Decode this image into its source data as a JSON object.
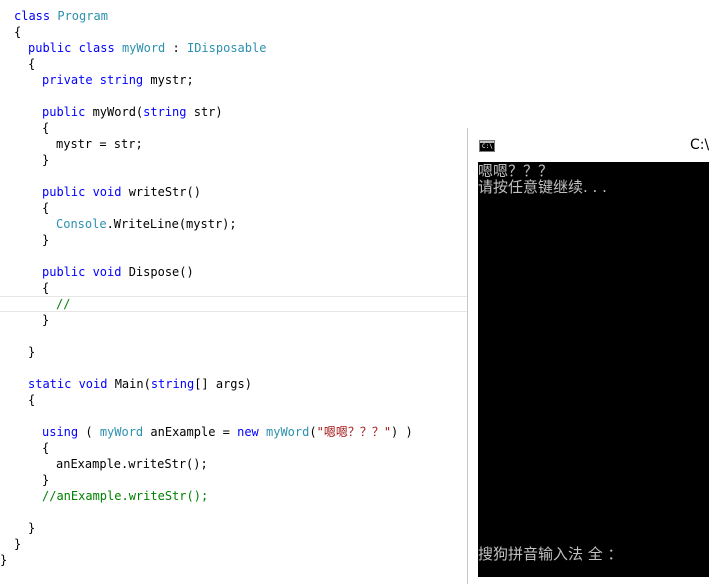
{
  "editor": {
    "lines": [
      {
        "indent": 2,
        "tokens": [
          {
            "t": "class ",
            "c": "kw"
          },
          {
            "t": "Program",
            "c": "type"
          }
        ]
      },
      {
        "indent": 2,
        "tokens": [
          {
            "t": "{",
            "c": "plain"
          }
        ]
      },
      {
        "indent": 4,
        "tokens": [
          {
            "t": "public ",
            "c": "kw"
          },
          {
            "t": "class ",
            "c": "kw"
          },
          {
            "t": "myWord",
            "c": "type"
          },
          {
            "t": " : ",
            "c": "plain"
          },
          {
            "t": "IDisposable",
            "c": "type"
          }
        ]
      },
      {
        "indent": 4,
        "tokens": [
          {
            "t": "{",
            "c": "plain"
          }
        ]
      },
      {
        "indent": 6,
        "tokens": [
          {
            "t": "private ",
            "c": "kw"
          },
          {
            "t": "string ",
            "c": "kw"
          },
          {
            "t": "mystr;",
            "c": "plain"
          }
        ]
      },
      {
        "indent": 0,
        "tokens": []
      },
      {
        "indent": 6,
        "tokens": [
          {
            "t": "public ",
            "c": "kw"
          },
          {
            "t": "myWord(",
            "c": "plain"
          },
          {
            "t": "string ",
            "c": "kw"
          },
          {
            "t": "str)",
            "c": "plain"
          }
        ]
      },
      {
        "indent": 6,
        "tokens": [
          {
            "t": "{",
            "c": "plain"
          }
        ]
      },
      {
        "indent": 8,
        "tokens": [
          {
            "t": "mystr = str;",
            "c": "plain"
          }
        ]
      },
      {
        "indent": 6,
        "tokens": [
          {
            "t": "}",
            "c": "plain"
          }
        ]
      },
      {
        "indent": 0,
        "tokens": []
      },
      {
        "indent": 6,
        "tokens": [
          {
            "t": "public ",
            "c": "kw"
          },
          {
            "t": "void ",
            "c": "kw"
          },
          {
            "t": "writeStr()",
            "c": "plain"
          }
        ]
      },
      {
        "indent": 6,
        "tokens": [
          {
            "t": "{",
            "c": "plain"
          }
        ]
      },
      {
        "indent": 8,
        "tokens": [
          {
            "t": "Console",
            "c": "type"
          },
          {
            "t": ".WriteLine(mystr);",
            "c": "plain"
          }
        ]
      },
      {
        "indent": 6,
        "tokens": [
          {
            "t": "}",
            "c": "plain"
          }
        ]
      },
      {
        "indent": 0,
        "tokens": []
      },
      {
        "indent": 6,
        "tokens": [
          {
            "t": "public ",
            "c": "kw"
          },
          {
            "t": "void ",
            "c": "kw"
          },
          {
            "t": "Dispose()",
            "c": "plain"
          }
        ]
      },
      {
        "indent": 6,
        "tokens": [
          {
            "t": "{",
            "c": "plain"
          }
        ]
      },
      {
        "indent": 8,
        "tokens": [
          {
            "t": "//",
            "c": "comment"
          }
        ]
      },
      {
        "indent": 6,
        "tokens": [
          {
            "t": "}",
            "c": "plain"
          }
        ]
      },
      {
        "indent": 0,
        "tokens": []
      },
      {
        "indent": 4,
        "tokens": [
          {
            "t": "}",
            "c": "plain"
          }
        ]
      },
      {
        "indent": 0,
        "tokens": []
      },
      {
        "indent": 4,
        "tokens": [
          {
            "t": "static ",
            "c": "kw"
          },
          {
            "t": "void ",
            "c": "kw"
          },
          {
            "t": "Main(",
            "c": "plain"
          },
          {
            "t": "string",
            "c": "kw"
          },
          {
            "t": "[] args)",
            "c": "plain"
          }
        ]
      },
      {
        "indent": 4,
        "tokens": [
          {
            "t": "{",
            "c": "plain"
          }
        ]
      },
      {
        "indent": 0,
        "tokens": []
      },
      {
        "indent": 6,
        "tokens": [
          {
            "t": "using",
            "c": "kw"
          },
          {
            "t": " ( ",
            "c": "plain"
          },
          {
            "t": "myWord",
            "c": "type"
          },
          {
            "t": " anExample = ",
            "c": "plain"
          },
          {
            "t": "new ",
            "c": "kw"
          },
          {
            "t": "myWord",
            "c": "type"
          },
          {
            "t": "(",
            "c": "plain"
          },
          {
            "t": "\"嗯嗯？？？\"",
            "c": "str"
          },
          {
            "t": ") )",
            "c": "plain"
          }
        ]
      },
      {
        "indent": 6,
        "tokens": [
          {
            "t": "{",
            "c": "plain"
          }
        ]
      },
      {
        "indent": 8,
        "tokens": [
          {
            "t": "anExample.writeStr();",
            "c": "plain"
          }
        ]
      },
      {
        "indent": 6,
        "tokens": [
          {
            "t": "}",
            "c": "plain"
          }
        ]
      },
      {
        "indent": 6,
        "tokens": [
          {
            "t": "//anExample.writeStr();",
            "c": "comment"
          }
        ]
      },
      {
        "indent": 0,
        "tokens": []
      },
      {
        "indent": 4,
        "tokens": [
          {
            "t": "}",
            "c": "plain"
          }
        ]
      },
      {
        "indent": 2,
        "tokens": [
          {
            "t": "}",
            "c": "plain"
          }
        ]
      },
      {
        "indent": 0,
        "tokens": [
          {
            "t": "}",
            "c": "plain"
          }
        ]
      }
    ],
    "colors": {
      "kw": "#0000ff",
      "type": "#2b91af",
      "str": "#a31515",
      "comment": "#008000",
      "plain": "#000000"
    }
  },
  "console": {
    "icon": "console-app-icon",
    "icon_glyph": "C:\\",
    "title": "C:\\",
    "output": [
      "嗯嗯？？？",
      "请按任意键继续. . ."
    ],
    "ime_status": "搜狗拼音输入法 全 ："
  }
}
